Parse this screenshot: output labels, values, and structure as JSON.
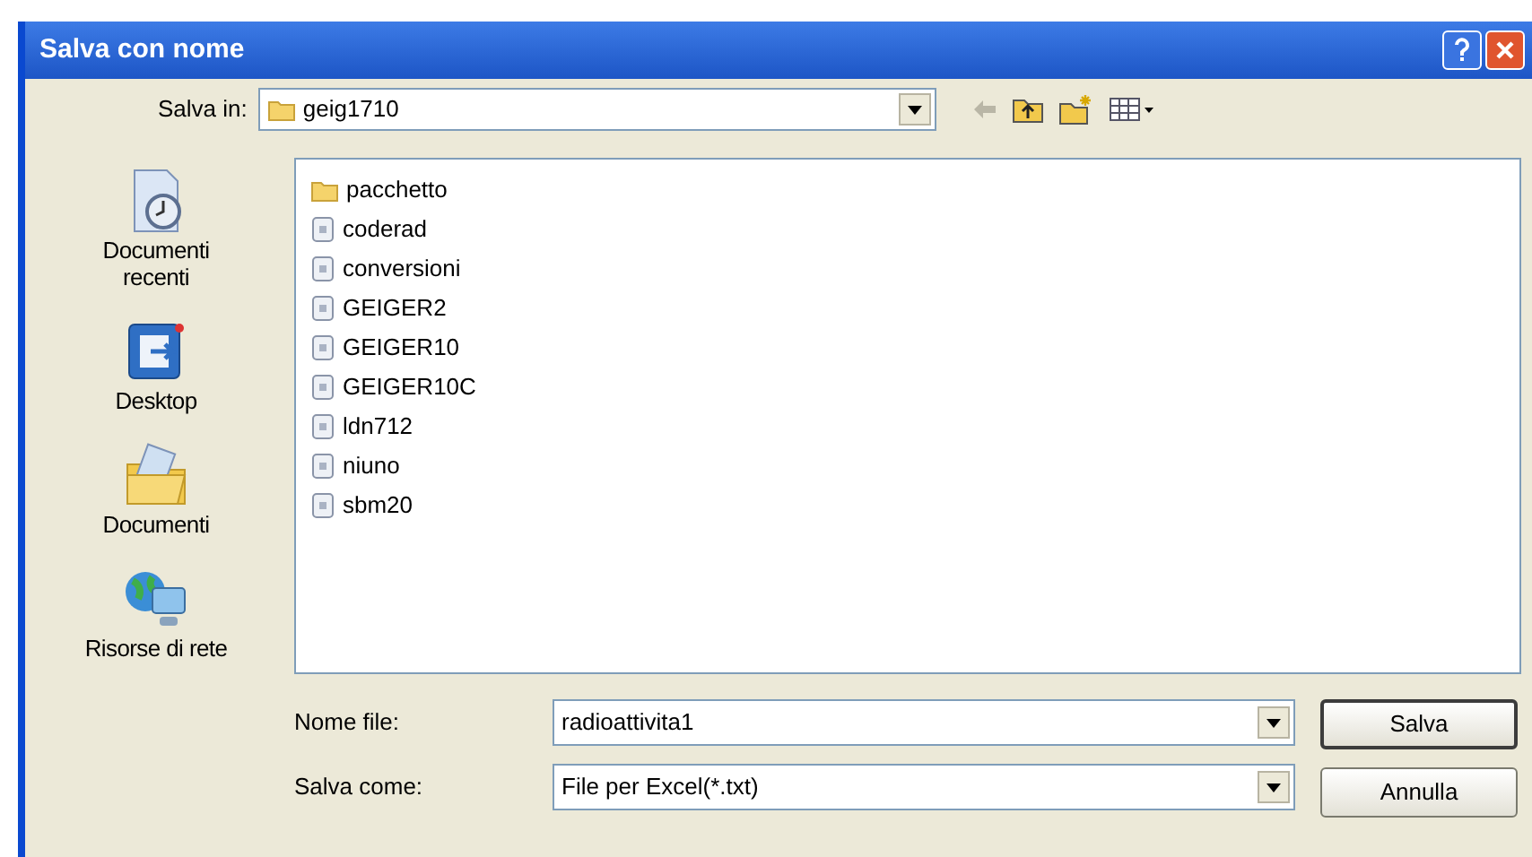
{
  "window": {
    "title": "Salva con nome"
  },
  "save_in": {
    "label": "Salva in:",
    "value": "geig1710"
  },
  "places": [
    {
      "label": "Documenti recenti",
      "kind": "recent"
    },
    {
      "label": "Desktop",
      "kind": "desktop"
    },
    {
      "label": "Documenti",
      "kind": "documents"
    },
    {
      "label": "Risorse di rete",
      "kind": "network"
    }
  ],
  "files": [
    {
      "name": "pacchetto",
      "kind": "folder"
    },
    {
      "name": "coderad",
      "kind": "file"
    },
    {
      "name": "conversioni",
      "kind": "file"
    },
    {
      "name": "GEIGER2",
      "kind": "file"
    },
    {
      "name": "GEIGER10",
      "kind": "file"
    },
    {
      "name": "GEIGER10C",
      "kind": "file"
    },
    {
      "name": "ldn712",
      "kind": "file"
    },
    {
      "name": "niuno",
      "kind": "file"
    },
    {
      "name": "sbm20",
      "kind": "file"
    }
  ],
  "file_name": {
    "label": "Nome file:",
    "value": "radioattivita1"
  },
  "save_as_type": {
    "label": "Salva come:",
    "value": "File per Excel(*.txt)"
  },
  "buttons": [
    "Salva",
    "Annulla"
  ]
}
